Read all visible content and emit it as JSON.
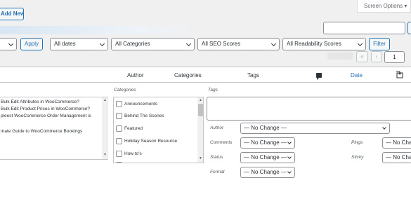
{
  "header": {
    "add_new": "Add New",
    "screen_options": "Screen Options ▾"
  },
  "filters": {
    "bulk_select": "",
    "apply": "Apply",
    "dates": "All dates",
    "categories": "All Categories",
    "seo": "All SEO Scores",
    "readability": "All Readability Scores",
    "filter": "Filter"
  },
  "pagination": {
    "first": "«",
    "prev": "‹",
    "page": "1"
  },
  "table": {
    "headers": {
      "author": "Author",
      "categories": "Categories",
      "tags": "Tags",
      "date": "Date"
    }
  },
  "quick_edit": {
    "post_titles": [
      "Bulk Edit Attributes in WooCommerce?",
      "Bulk Edit Product Prices in WooCommerce?",
      "pleest WooCommerce Order Management is",
      "",
      "mate Guide to WooCommerce Bookings"
    ],
    "categories_label": "Categories",
    "category_items": [
      "Announcements",
      "Behind The Scenes",
      "Featured",
      "Holiday Season Resource",
      "How to's"
    ],
    "tags_label": "Tags",
    "fields": {
      "author_label": "Author",
      "author_value": "— No Change —",
      "comments_label": "Comments",
      "comments_value": "— No Change —",
      "status_label": "Status",
      "status_value": "— No Change —",
      "format_label": "Format",
      "format_value": "— No Change —",
      "pings_label": "Pings",
      "pings_value": "— No Cha",
      "sticky_label": "Sticky",
      "sticky_value": "— No Cha"
    }
  }
}
